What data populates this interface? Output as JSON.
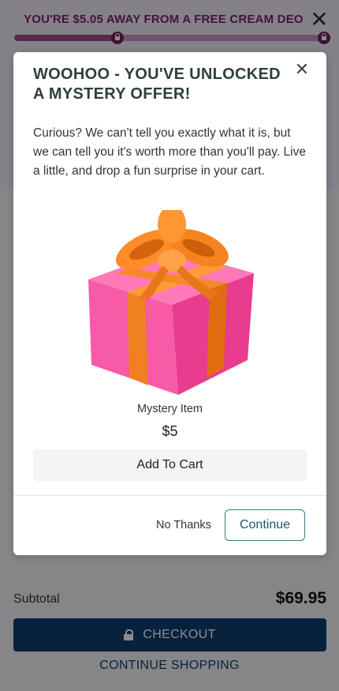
{
  "promo": {
    "message": "YOU'RE $5.05 AWAY FROM A FREE CREAM DEO",
    "progress": 0.33,
    "close_icon": "close-icon"
  },
  "modal": {
    "title": "WOOHOO - YOU'VE UNLOCKED A MYSTERY OFFER!",
    "description": "Curious? We can't tell you exactly what it is, but we can tell you it's worth more than you'll pay. Live a little, and drop a fun surprise in your cart.",
    "close_icon": "close-icon",
    "image_icon": "gift-icon",
    "item_name": "Mystery Item",
    "item_price": "$5",
    "add_to_cart_label": "Add To Cart",
    "no_thanks_label": "No Thanks",
    "continue_label": "Continue"
  },
  "cart": {
    "subtotal_label": "Subtotal",
    "subtotal_value": "$69.95",
    "checkout_label": "CHECKOUT",
    "continue_shopping_label": "CONTINUE SHOPPING"
  },
  "colors": {
    "promo_text": "#7a1f6c",
    "progress": "#a04b94",
    "checkout_bg": "#0f3d70",
    "continue_border": "#3d7a84",
    "gift_box": "#f0509e",
    "ribbon": "#f07a1a"
  }
}
